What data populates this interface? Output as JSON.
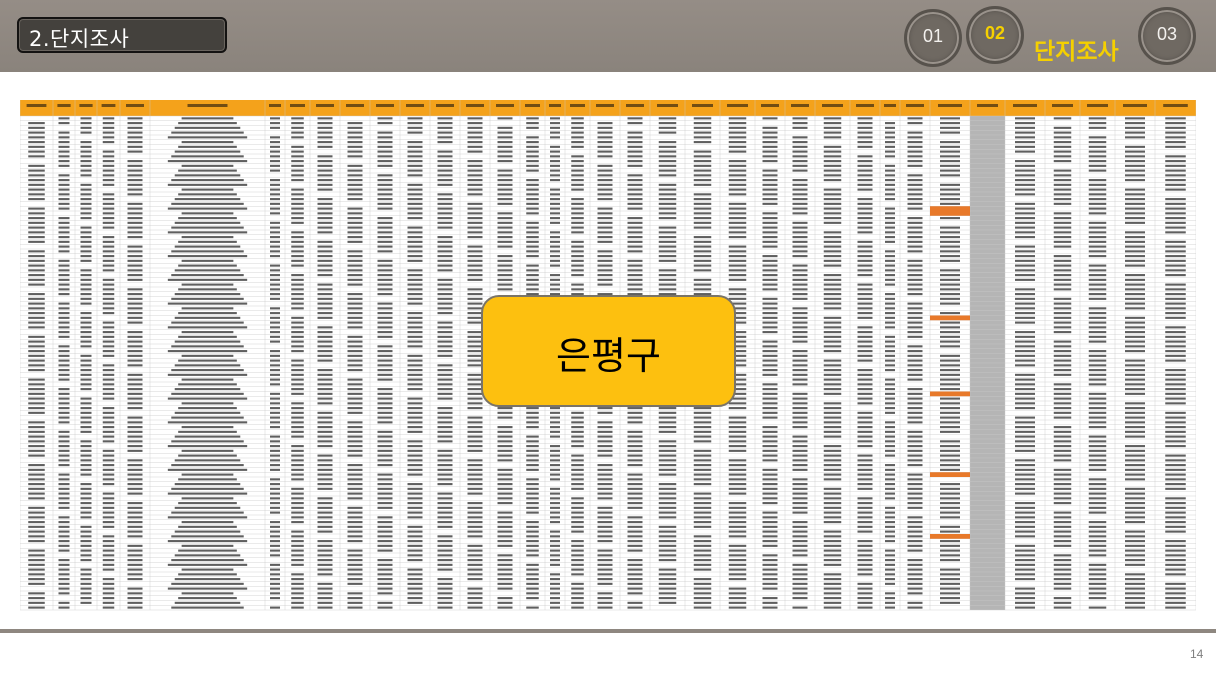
{
  "header": {
    "title": "2.단지조사",
    "steps": [
      {
        "label": "01",
        "active": false
      },
      {
        "label": "02",
        "active": true
      },
      {
        "label": "03",
        "active": false
      }
    ],
    "current_section": "단지조사"
  },
  "callout": {
    "text": "은평구"
  },
  "footer": {
    "page_number": "14"
  },
  "colors": {
    "header_bg": "#8e8780",
    "accent_yellow": "#f5d000",
    "callout_bg": "#fdc00f",
    "table_header_orange": "#f4a21b",
    "highlight_orange": "#e8792a",
    "gray_column": "#b5b5b5"
  }
}
